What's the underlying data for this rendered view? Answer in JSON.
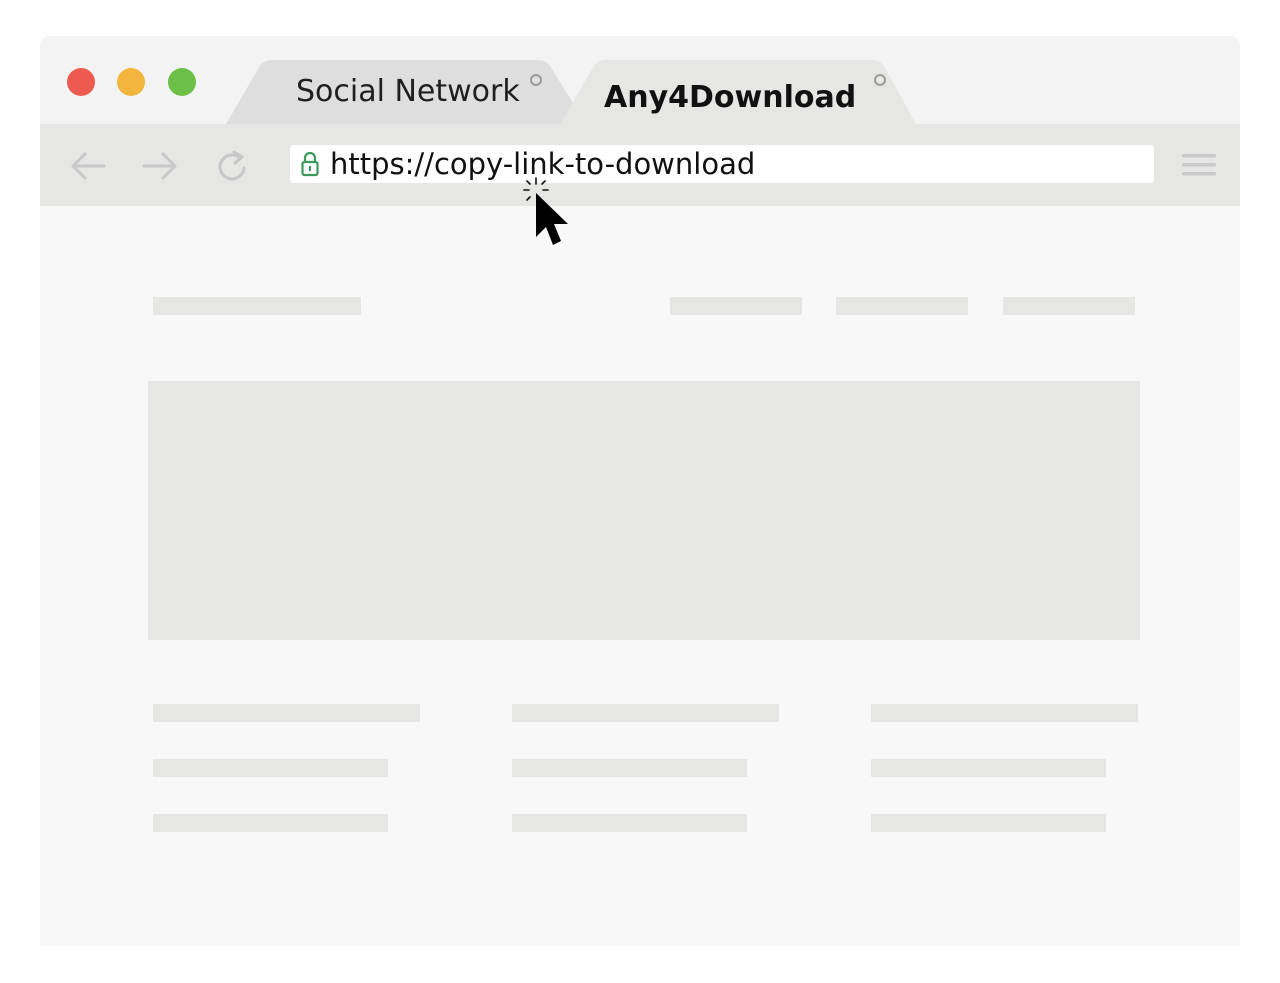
{
  "window": {
    "traffic_lights": [
      {
        "name": "close",
        "color": "#ed5a4f"
      },
      {
        "name": "minimize",
        "color": "#f2b63e"
      },
      {
        "name": "maximize",
        "color": "#6cc048"
      }
    ]
  },
  "tabs": [
    {
      "label": "Social Network",
      "active": false
    },
    {
      "label": "Any4Download",
      "active": true
    }
  ],
  "toolbar": {
    "back_icon": "arrow-left-icon",
    "forward_icon": "arrow-right-icon",
    "reload_icon": "reload-icon",
    "menu_icon": "hamburger-menu-icon"
  },
  "address_bar": {
    "secure": true,
    "lock_color": "#3a9a5b",
    "url": "https://copy-link-to-download"
  },
  "colors": {
    "placeholder": "#e6e6e5",
    "page_background": "#f8f8f8",
    "toolbar_background": "#e6e6e5"
  }
}
